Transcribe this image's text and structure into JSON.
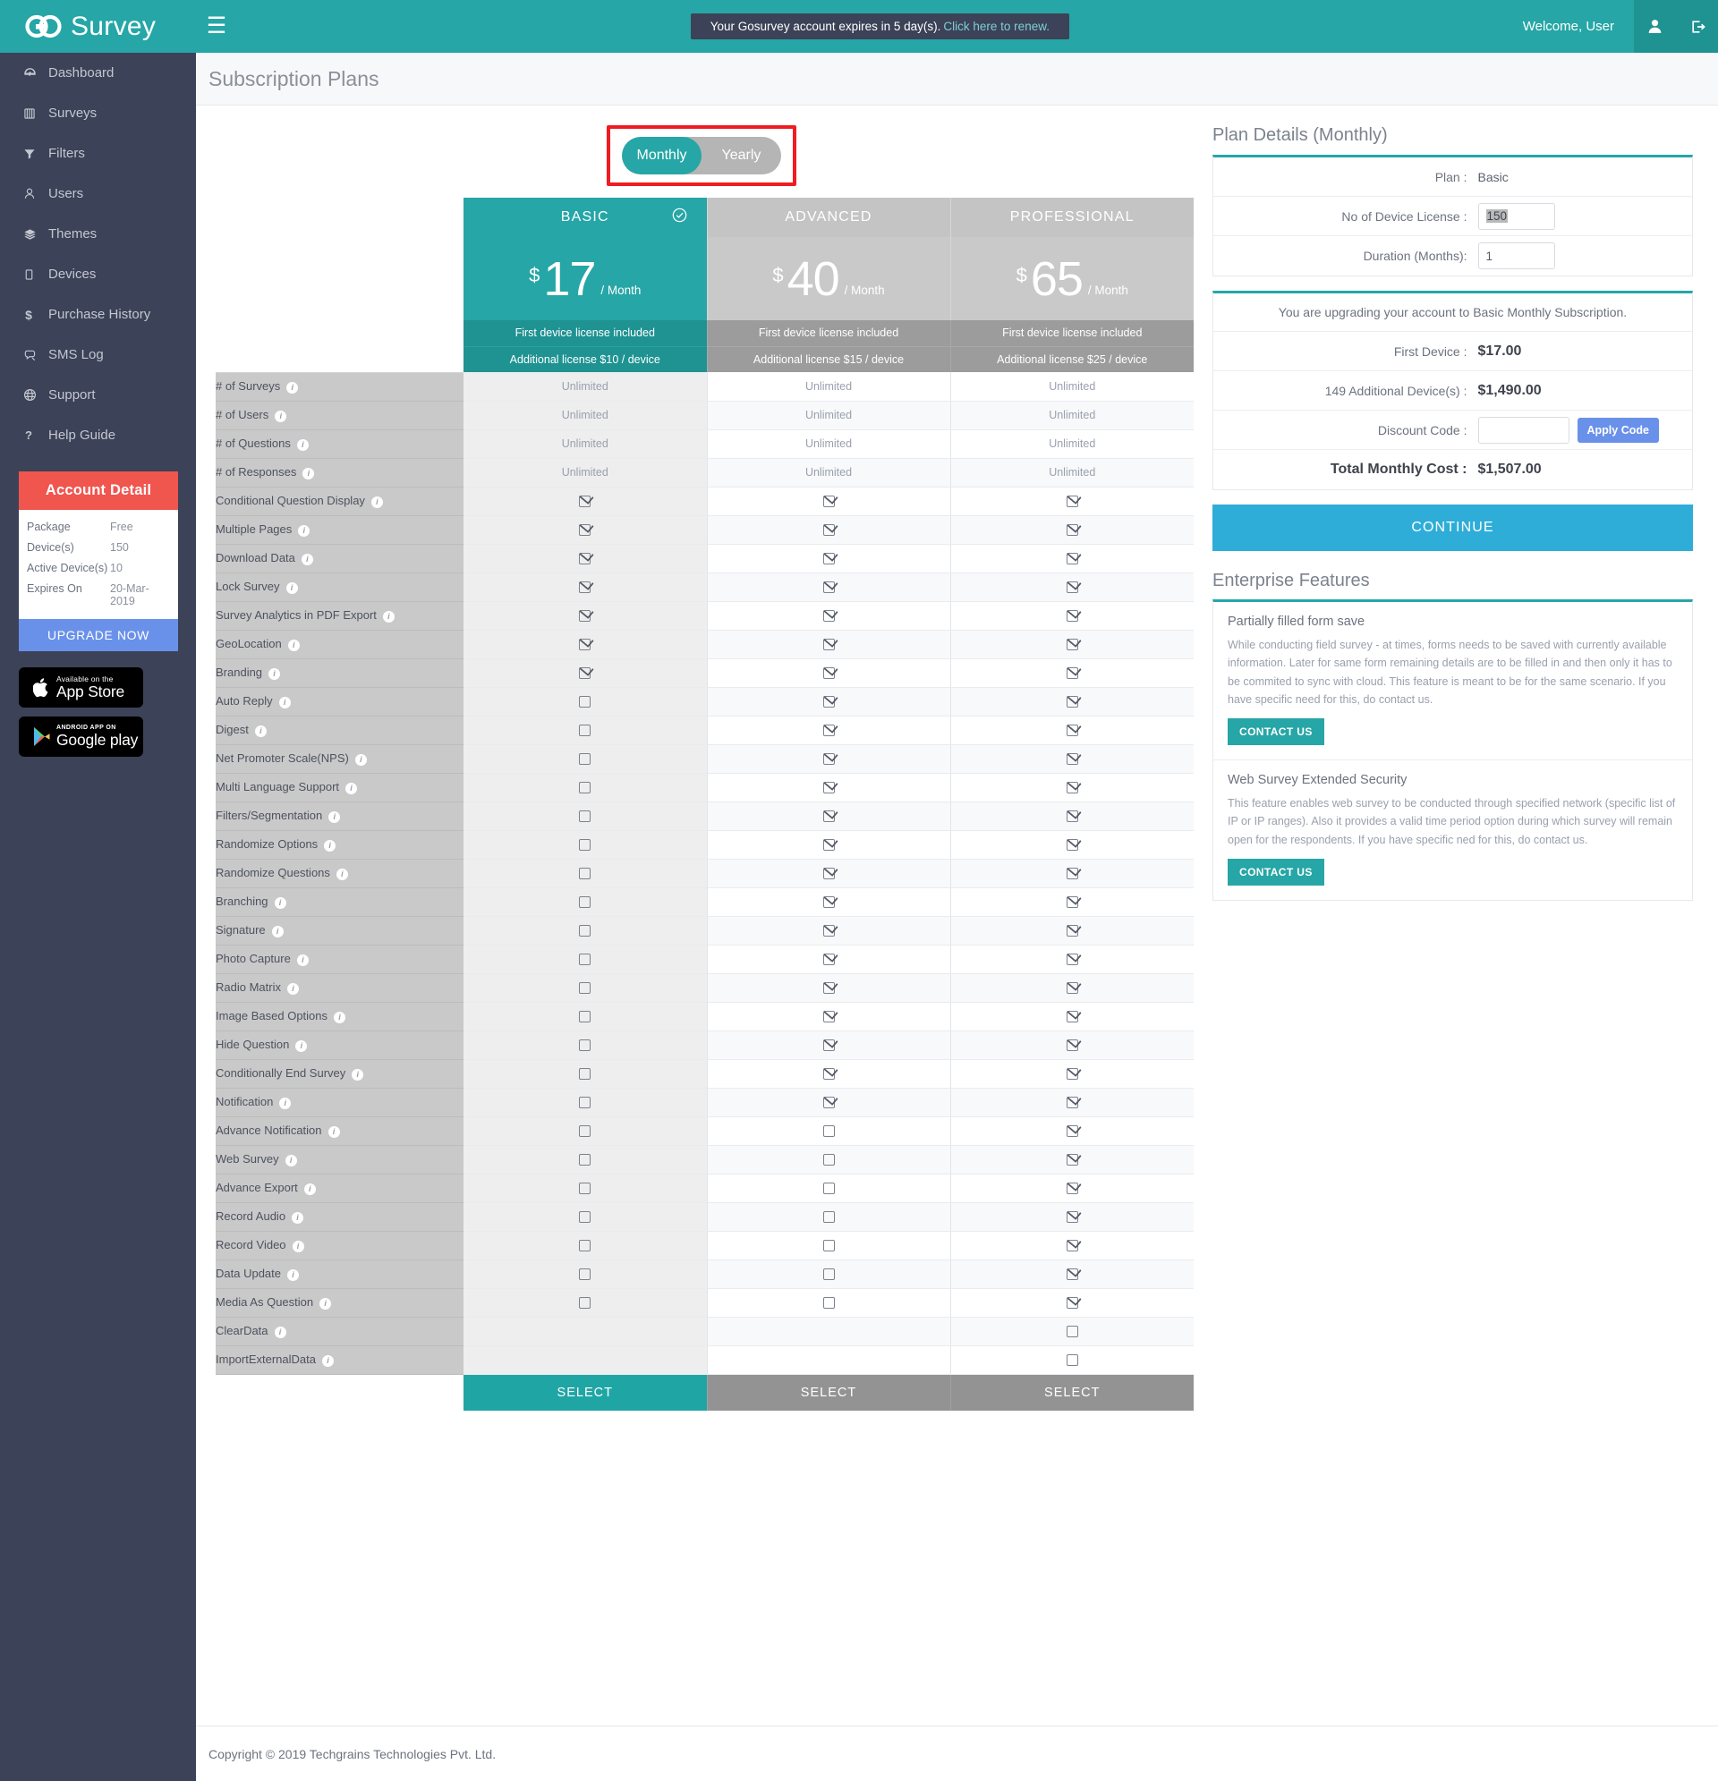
{
  "app": {
    "brand_go": "GO",
    "brand_name": "Survey",
    "menu_icon": "hamburger-icon"
  },
  "topbar": {
    "notice_text": "Your Gosurvey account expires in 5 day(s).",
    "notice_link": "Click here to renew.",
    "welcome": "Welcome, User",
    "profile_icon": "user-icon",
    "logout_icon": "logout-icon"
  },
  "sidebar": {
    "items": [
      {
        "label": "Dashboard",
        "icon": "dashboard-icon"
      },
      {
        "label": "Surveys",
        "icon": "surveys-icon"
      },
      {
        "label": "Filters",
        "icon": "filter-icon"
      },
      {
        "label": "Users",
        "icon": "users-icon"
      },
      {
        "label": "Themes",
        "icon": "themes-icon"
      },
      {
        "label": "Devices",
        "icon": "devices-icon"
      },
      {
        "label": "Purchase History",
        "icon": "dollar-icon"
      },
      {
        "label": "SMS Log",
        "icon": "sms-icon"
      },
      {
        "label": "Support",
        "icon": "support-icon"
      },
      {
        "label": "Help Guide",
        "icon": "question-icon"
      }
    ],
    "account": {
      "title": "Account Detail",
      "rows": [
        {
          "key": "Package",
          "value": "Free"
        },
        {
          "key": "Device(s)",
          "value": "150"
        },
        {
          "key": "Active Device(s)",
          "value": "10"
        },
        {
          "key": "Expires On",
          "value": "20-Mar-2019"
        }
      ],
      "upgrade_label": "UPGRADE NOW"
    },
    "appstore": {
      "small": "Available on the",
      "big": "App Store",
      "icon": "apple-icon"
    },
    "googleplay": {
      "small": "ANDROID APP ON",
      "big": "Google play",
      "icon": "google-play-icon"
    }
  },
  "page": {
    "title": "Subscription Plans"
  },
  "billing_toggle": {
    "options": [
      "Monthly",
      "Yearly"
    ],
    "selected": "Monthly"
  },
  "plans": [
    {
      "name": "BASIC",
      "currency": "$",
      "amount": "17",
      "period": "/ Month",
      "first_license": "First device license included",
      "additional_license": "Additional license $10 / device",
      "select_label": "SELECT",
      "selected": true,
      "check_icon": "check-circle-icon"
    },
    {
      "name": "ADVANCED",
      "currency": "$",
      "amount": "40",
      "period": "/ Month",
      "first_license": "First device license included",
      "additional_license": "Additional license $15 / device",
      "select_label": "SELECT",
      "selected": false
    },
    {
      "name": "PROFESSIONAL",
      "currency": "$",
      "amount": "65",
      "period": "/ Month",
      "first_license": "First device license included",
      "additional_license": "Additional license $25 / device",
      "select_label": "SELECT",
      "selected": false
    }
  ],
  "features": [
    {
      "label": "# of Surveys",
      "values": [
        "Unlimited",
        "Unlimited",
        "Unlimited"
      ]
    },
    {
      "label": "# of Users",
      "values": [
        "Unlimited",
        "Unlimited",
        "Unlimited"
      ]
    },
    {
      "label": "# of Questions",
      "values": [
        "Unlimited",
        "Unlimited",
        "Unlimited"
      ]
    },
    {
      "label": "# of Responses",
      "values": [
        "Unlimited",
        "Unlimited",
        "Unlimited"
      ]
    },
    {
      "label": "Conditional Question Display",
      "values": [
        "checked",
        "checked",
        "checked"
      ]
    },
    {
      "label": "Multiple Pages",
      "values": [
        "checked",
        "checked",
        "checked"
      ]
    },
    {
      "label": "Download Data",
      "values": [
        "checked",
        "checked",
        "checked"
      ]
    },
    {
      "label": "Lock Survey",
      "values": [
        "checked",
        "checked",
        "checked"
      ]
    },
    {
      "label": "Survey Analytics in PDF Export",
      "values": [
        "checked",
        "checked",
        "checked"
      ]
    },
    {
      "label": "GeoLocation",
      "values": [
        "checked",
        "checked",
        "checked"
      ]
    },
    {
      "label": "Branding",
      "values": [
        "checked",
        "checked",
        "checked"
      ]
    },
    {
      "label": "Auto Reply",
      "values": [
        "unchecked",
        "checked",
        "checked"
      ]
    },
    {
      "label": "Digest",
      "values": [
        "unchecked",
        "checked",
        "checked"
      ]
    },
    {
      "label": "Net Promoter Scale(NPS)",
      "values": [
        "unchecked",
        "checked",
        "checked"
      ]
    },
    {
      "label": "Multi Language Support",
      "values": [
        "unchecked",
        "checked",
        "checked"
      ]
    },
    {
      "label": "Filters/Segmentation",
      "values": [
        "unchecked",
        "checked",
        "checked"
      ]
    },
    {
      "label": "Randomize Options",
      "values": [
        "unchecked",
        "checked",
        "checked"
      ]
    },
    {
      "label": "Randomize Questions",
      "values": [
        "unchecked",
        "checked",
        "checked"
      ]
    },
    {
      "label": "Branching",
      "values": [
        "unchecked",
        "checked",
        "checked"
      ]
    },
    {
      "label": "Signature",
      "values": [
        "unchecked",
        "checked",
        "checked"
      ]
    },
    {
      "label": "Photo Capture",
      "values": [
        "unchecked",
        "checked",
        "checked"
      ]
    },
    {
      "label": "Radio Matrix",
      "values": [
        "unchecked",
        "checked",
        "checked"
      ]
    },
    {
      "label": "Image Based Options",
      "values": [
        "unchecked",
        "checked",
        "checked"
      ]
    },
    {
      "label": "Hide Question",
      "values": [
        "unchecked",
        "checked",
        "checked"
      ]
    },
    {
      "label": "Conditionally End Survey",
      "values": [
        "unchecked",
        "checked",
        "checked"
      ]
    },
    {
      "label": "Notification",
      "values": [
        "unchecked",
        "checked",
        "checked"
      ]
    },
    {
      "label": "Advance Notification",
      "values": [
        "unchecked",
        "unchecked",
        "checked"
      ]
    },
    {
      "label": "Web Survey",
      "values": [
        "unchecked",
        "unchecked",
        "checked"
      ]
    },
    {
      "label": "Advance Export",
      "values": [
        "unchecked",
        "unchecked",
        "checked"
      ]
    },
    {
      "label": "Record Audio",
      "values": [
        "unchecked",
        "unchecked",
        "checked"
      ]
    },
    {
      "label": "Record Video",
      "values": [
        "unchecked",
        "unchecked",
        "checked"
      ]
    },
    {
      "label": "Data Update",
      "values": [
        "unchecked",
        "unchecked",
        "checked"
      ]
    },
    {
      "label": "Media As Question",
      "values": [
        "unchecked",
        "unchecked",
        "checked"
      ]
    },
    {
      "label": "ClearData",
      "values": [
        "",
        "",
        "unchecked"
      ]
    },
    {
      "label": "ImportExternalData",
      "values": [
        "",
        "",
        "unchecked"
      ]
    }
  ],
  "plan_details": {
    "title": "Plan Details (Monthly)",
    "plan_label": "Plan :",
    "plan_value": "Basic",
    "device_license_label": "No of Device License :",
    "device_license_value": "150",
    "duration_label": "Duration (Months):",
    "duration_value": "1",
    "upgrade_note": "You are upgrading your account to Basic Monthly Subscription.",
    "first_device_label": "First Device :",
    "first_device_value": "$17.00",
    "additional_label": "149 Additional Device(s) :",
    "additional_value": "$1,490.00",
    "discount_label": "Discount Code :",
    "discount_value": "",
    "apply_label": "Apply Code",
    "total_label": "Total Monthly Cost :",
    "total_value": "$1,507.00",
    "continue_label": "CONTINUE"
  },
  "enterprise": {
    "title": "Enterprise Features",
    "items": [
      {
        "heading": "Partially filled form save",
        "body": "While conducting field survey - at times, forms needs to be saved with currently available information. Later for same form remaining details are to be filled in and then only it has to be commited to sync with cloud. This feature is meant to be for the same scenario. If you have specific need for this, do contact us.",
        "button": "CONTACT US"
      },
      {
        "heading": "Web Survey Extended Security",
        "body": "This feature enables web survey to be conducted through specified network (specific list of IP or IP ranges). Also it provides a valid time period option during which survey will remain open for the respondents. If you have specific ned for this, do contact us.",
        "button": "CONTACT US"
      }
    ]
  },
  "footer": {
    "copyright": "Copyright © 2019 Techgrains Technologies Pvt. Ltd."
  },
  "colors": {
    "teal": "#26a6a6",
    "dark_teal": "#1f9292",
    "sidebar": "#3c4257",
    "red_accent": "#f0554e",
    "blue": "#6a91ea",
    "continue_blue": "#2eadd8",
    "highlight_red": "#ef1c22"
  }
}
